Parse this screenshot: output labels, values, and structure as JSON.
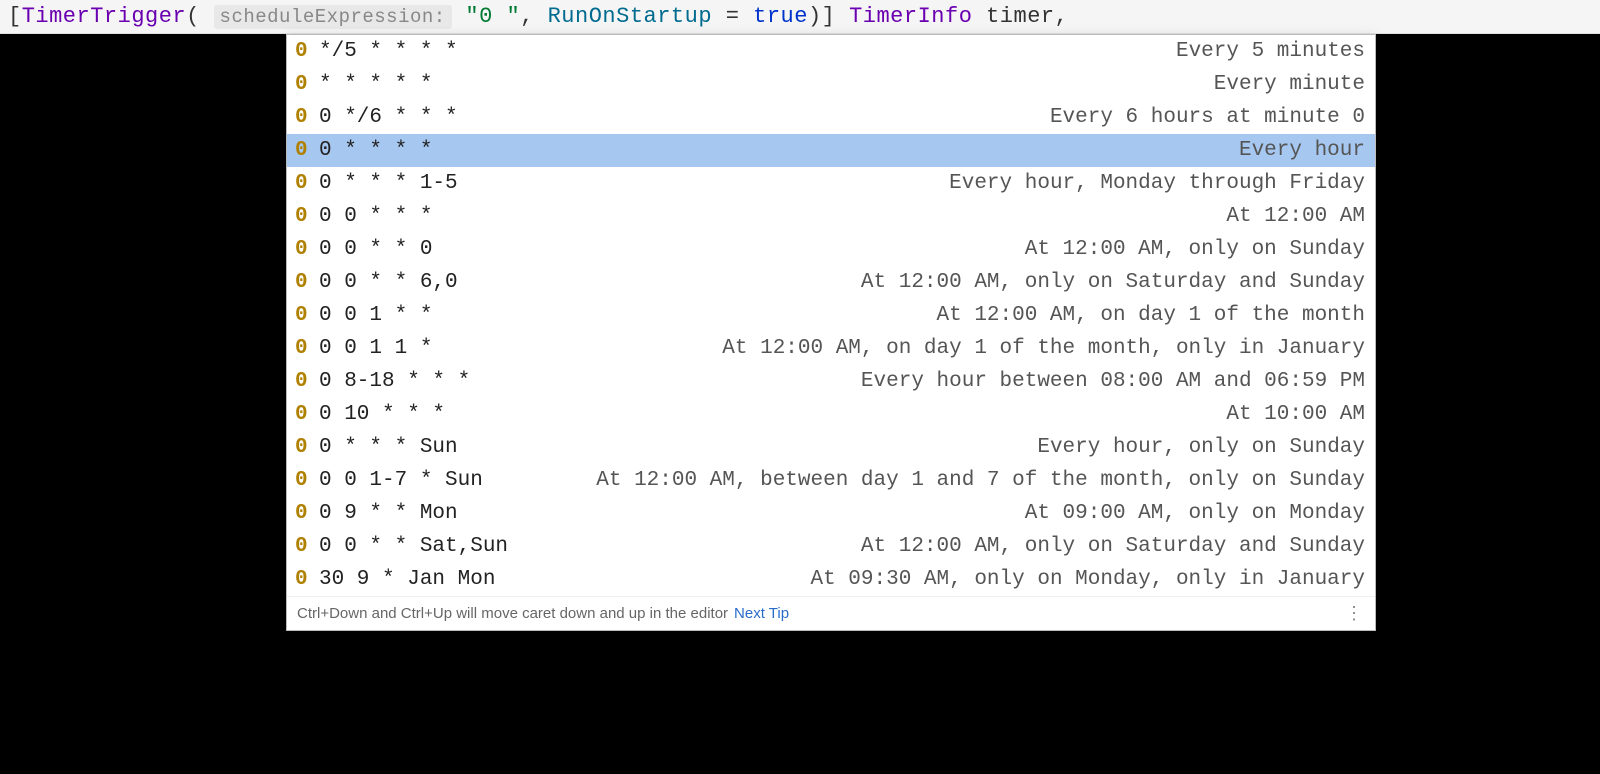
{
  "code": {
    "open_bracket": "[",
    "type_name": "TimerTrigger",
    "open_paren": "(",
    "param_hint": "scheduleExpression:",
    "string_value": "\"0 \"",
    "comma": ",",
    "prop_name": "RunOnStartup",
    "equals": " = ",
    "bool_value": "true",
    "close_paren_bracket": ")]",
    "return_type": "TimerInfo",
    "var_name": "timer",
    "trailing_comma": ","
  },
  "suggestions": [
    {
      "marker": "0",
      "expr": "*/5 * * * *",
      "desc": "Every 5 minutes",
      "selected": false
    },
    {
      "marker": "0",
      "expr": "* * * * *",
      "desc": "Every minute",
      "selected": false
    },
    {
      "marker": "0",
      "expr": "0 */6 * * *",
      "desc": "Every 6 hours at minute 0",
      "selected": false
    },
    {
      "marker": "0",
      "expr": "0 * * * *",
      "desc": "Every hour",
      "selected": true
    },
    {
      "marker": "0",
      "expr": "0 * * * 1-5",
      "desc": "Every hour, Monday through Friday",
      "selected": false
    },
    {
      "marker": "0",
      "expr": "0 0 * * *",
      "desc": "At 12:00 AM",
      "selected": false
    },
    {
      "marker": "0",
      "expr": "0 0 * * 0",
      "desc": "At 12:00 AM, only on Sunday",
      "selected": false
    },
    {
      "marker": "0",
      "expr": "0 0 * * 6,0",
      "desc": "At 12:00 AM, only on Saturday and Sunday",
      "selected": false
    },
    {
      "marker": "0",
      "expr": "0 0 1 * *",
      "desc": "At 12:00 AM, on day 1 of the month",
      "selected": false
    },
    {
      "marker": "0",
      "expr": "0 0 1 1 *",
      "desc": "At 12:00 AM, on day 1 of the month, only in January",
      "selected": false
    },
    {
      "marker": "0",
      "expr": "0 8-18 * * *",
      "desc": "Every hour between 08:00 AM and 06:59 PM",
      "selected": false
    },
    {
      "marker": "0",
      "expr": "0 10 * * *",
      "desc": "At 10:00 AM",
      "selected": false
    },
    {
      "marker": "0",
      "expr": "0 * * * Sun",
      "desc": "Every hour, only on Sunday",
      "selected": false
    },
    {
      "marker": "0",
      "expr": "0 0 1-7 * Sun",
      "desc": "At 12:00 AM, between day 1 and 7 of the month, only on Sunday",
      "selected": false
    },
    {
      "marker": "0",
      "expr": "0 9 * * Mon",
      "desc": "At 09:00 AM, only on Monday",
      "selected": false
    },
    {
      "marker": "0",
      "expr": "0 0 * * Sat,Sun",
      "desc": "At 12:00 AM, only on Saturday and Sunday",
      "selected": false
    },
    {
      "marker": "0",
      "expr": "30 9 * Jan Mon",
      "desc": "At 09:30 AM, only on Monday, only in January",
      "selected": false
    }
  ],
  "footer": {
    "tip": "Ctrl+Down and Ctrl+Up will move caret down and up in the editor",
    "link": "Next Tip",
    "more_glyph": "⋮"
  }
}
